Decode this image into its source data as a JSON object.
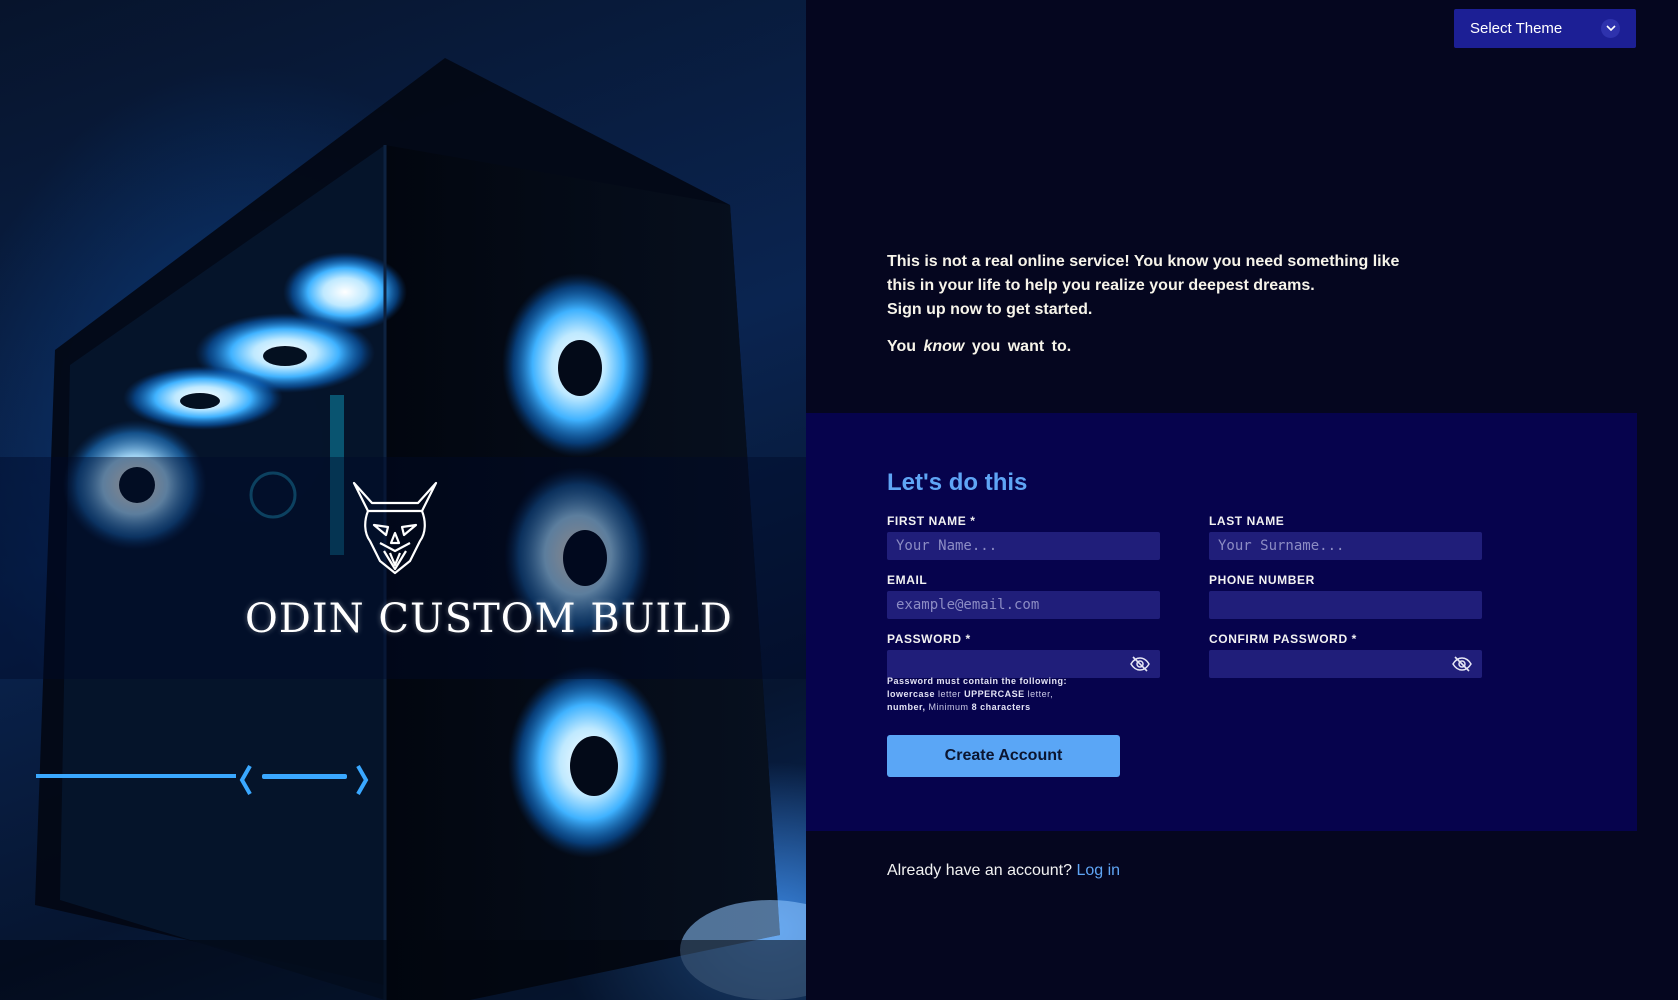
{
  "theme_selector": {
    "label": "Select Theme",
    "icon": "chevron-down-icon"
  },
  "hero": {
    "brand": "ODIN CUSTOM BUILD",
    "logo_icon": "viking-skull-icon"
  },
  "intro": {
    "line1": "This is not a real online service! You know you need something like",
    "line2": "this in your life to help you realize your deepest dreams.",
    "line3": "Sign up now to get started.",
    "tag_before": "You",
    "tag_emphasis": "know",
    "tag_after": "you want to."
  },
  "form": {
    "title": "Let's do this",
    "first_name": {
      "label": "FIRST NAME *",
      "placeholder": "Your Name...",
      "value": ""
    },
    "last_name": {
      "label": "LAST NAME",
      "placeholder": "Your Surname...",
      "value": ""
    },
    "email": {
      "label": "EMAIL",
      "placeholder": "example@email.com",
      "value": ""
    },
    "phone": {
      "label": "PHONE NUMBER",
      "placeholder": "",
      "value": ""
    },
    "password": {
      "label": "PASSWORD *",
      "placeholder": "",
      "value": "",
      "icon": "eye-slash-icon"
    },
    "confirm_password": {
      "label": "CONFIRM PASSWORD *",
      "placeholder": "",
      "value": "",
      "icon": "eye-slash-icon"
    },
    "hint": {
      "intro": "Password must contain the following:",
      "lowercase": "lowercase",
      "letter1": "letter",
      "uppercase": "UPPERCASE",
      "letter2": "letter,",
      "number": "number,",
      "minimum": "Minimum",
      "eight": "8 characters"
    },
    "submit_label": "Create Account"
  },
  "footer": {
    "prompt": "Already have an account?",
    "login_link": "Log in"
  },
  "colors": {
    "accent": "#5fa5f5",
    "card_bg": "#06034d",
    "input_bg": "#201e7a",
    "theme_button": "#1c1f95",
    "page_bg": "#05061f"
  }
}
